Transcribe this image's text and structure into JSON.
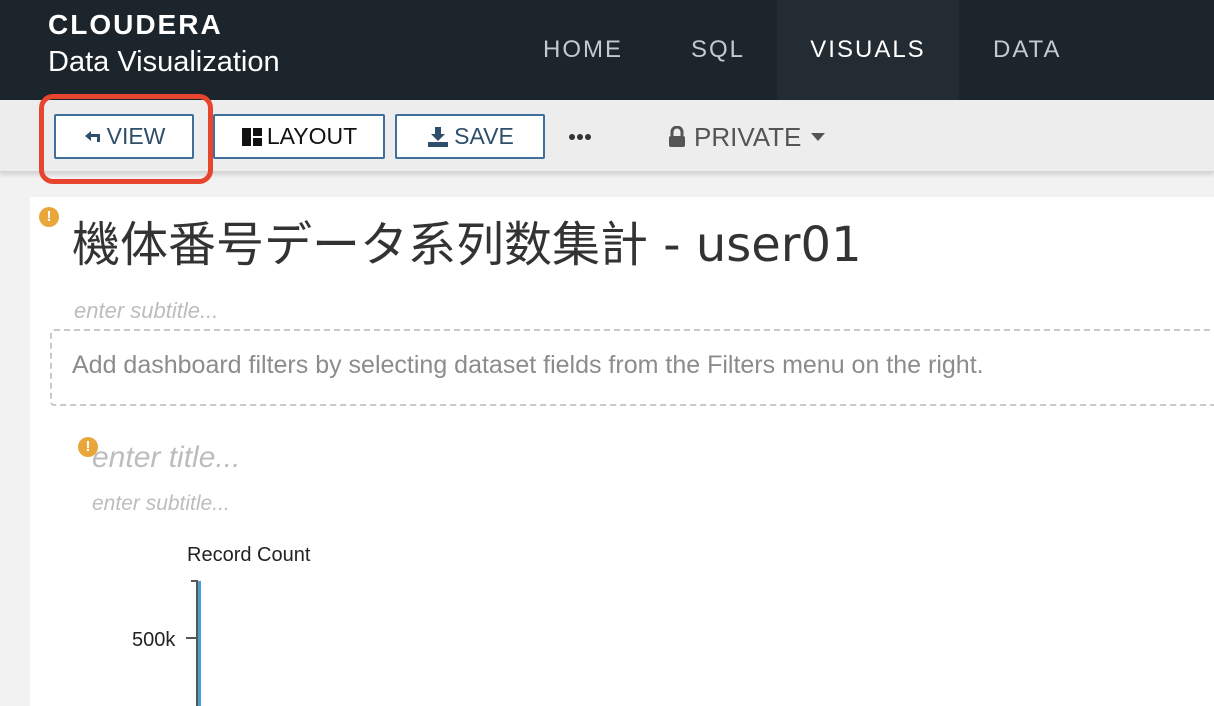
{
  "brand": {
    "name": "CLOUDERA",
    "product": "Data Visualization"
  },
  "nav": {
    "tabs": [
      {
        "label": "HOME",
        "active": false
      },
      {
        "label": "SQL",
        "active": false
      },
      {
        "label": "VISUALS",
        "active": true
      },
      {
        "label": "DATA",
        "active": false
      }
    ]
  },
  "toolbar": {
    "view_label": "VIEW",
    "layout_label": "LAYOUT",
    "save_label": "SAVE",
    "more_icon": "ellipsis-icon",
    "privacy_label": "PRIVATE"
  },
  "dashboard": {
    "title": "機体番号データ系列数集計 - user01",
    "subtitle_placeholder": "enter subtitle...",
    "filter_hint": "Add dashboard filters by selecting dataset fields from the Filters menu on the right."
  },
  "visual": {
    "title_placeholder": "enter title...",
    "subtitle_placeholder": "enter subtitle..."
  },
  "chart_data": {
    "type": "bar",
    "ylabel": "Record Count",
    "y_ticks": [
      "500k"
    ]
  },
  "colors": {
    "topbar": "#1c252b",
    "accent": "#5aa6dd",
    "highlight": "#e8452f",
    "warning": "#e9a63a"
  }
}
